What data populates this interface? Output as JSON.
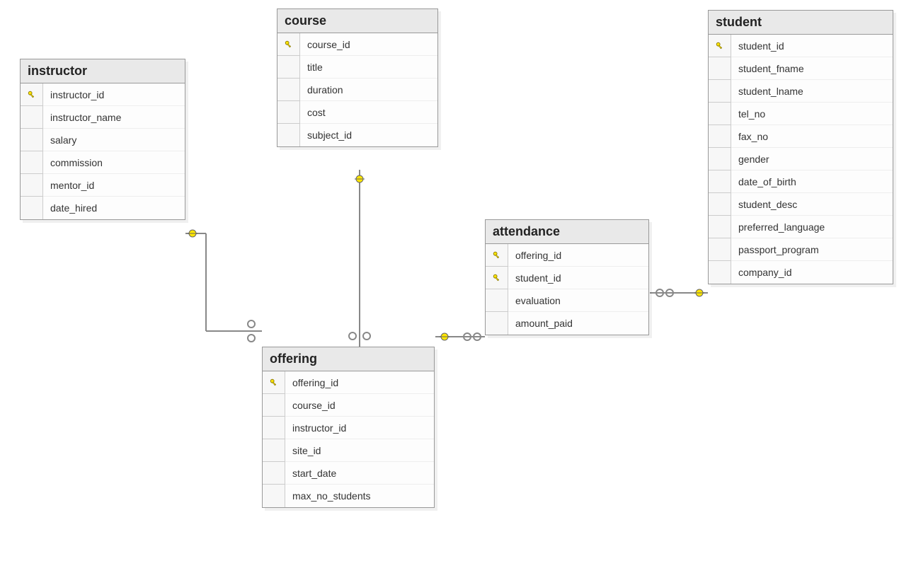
{
  "diagram_type": "entity-relationship",
  "tables": [
    {
      "id": "instructor",
      "name": "instructor",
      "columns": [
        {
          "name": "instructor_id",
          "pk": true
        },
        {
          "name": "instructor_name",
          "pk": false
        },
        {
          "name": "salary",
          "pk": false
        },
        {
          "name": "commission",
          "pk": false
        },
        {
          "name": "mentor_id",
          "pk": false
        },
        {
          "name": "date_hired",
          "pk": false
        }
      ]
    },
    {
      "id": "course",
      "name": "course",
      "columns": [
        {
          "name": "course_id",
          "pk": true
        },
        {
          "name": "title",
          "pk": false
        },
        {
          "name": "duration",
          "pk": false
        },
        {
          "name": "cost",
          "pk": false
        },
        {
          "name": "subject_id",
          "pk": false
        }
      ]
    },
    {
      "id": "offering",
      "name": "offering",
      "columns": [
        {
          "name": "offering_id",
          "pk": true
        },
        {
          "name": "course_id",
          "pk": false
        },
        {
          "name": "instructor_id",
          "pk": false
        },
        {
          "name": "site_id",
          "pk": false
        },
        {
          "name": "start_date",
          "pk": false
        },
        {
          "name": "max_no_students",
          "pk": false
        }
      ]
    },
    {
      "id": "attendance",
      "name": "attendance",
      "columns": [
        {
          "name": "offering_id",
          "pk": true
        },
        {
          "name": "student_id",
          "pk": true
        },
        {
          "name": "evaluation",
          "pk": false
        },
        {
          "name": "amount_paid",
          "pk": false
        }
      ]
    },
    {
      "id": "student",
      "name": "student",
      "columns": [
        {
          "name": "student_id",
          "pk": true
        },
        {
          "name": "student_fname",
          "pk": false
        },
        {
          "name": "student_lname",
          "pk": false
        },
        {
          "name": "tel_no",
          "pk": false
        },
        {
          "name": "fax_no",
          "pk": false
        },
        {
          "name": "gender",
          "pk": false
        },
        {
          "name": "date_of_birth",
          "pk": false
        },
        {
          "name": "student_desc",
          "pk": false
        },
        {
          "name": "preferred_language",
          "pk": false
        },
        {
          "name": "passport_program",
          "pk": false
        },
        {
          "name": "company_id",
          "pk": false
        }
      ]
    }
  ],
  "relationships": [
    {
      "from_table": "instructor",
      "from_column": "instructor_id",
      "to_table": "offering",
      "to_column": "instructor_id",
      "type": "one-to-many"
    },
    {
      "from_table": "course",
      "from_column": "course_id",
      "to_table": "offering",
      "to_column": "course_id",
      "type": "one-to-many"
    },
    {
      "from_table": "offering",
      "from_column": "offering_id",
      "to_table": "attendance",
      "to_column": "offering_id",
      "type": "one-to-many"
    },
    {
      "from_table": "student",
      "from_column": "student_id",
      "to_table": "attendance",
      "to_column": "student_id",
      "type": "one-to-many"
    }
  ]
}
